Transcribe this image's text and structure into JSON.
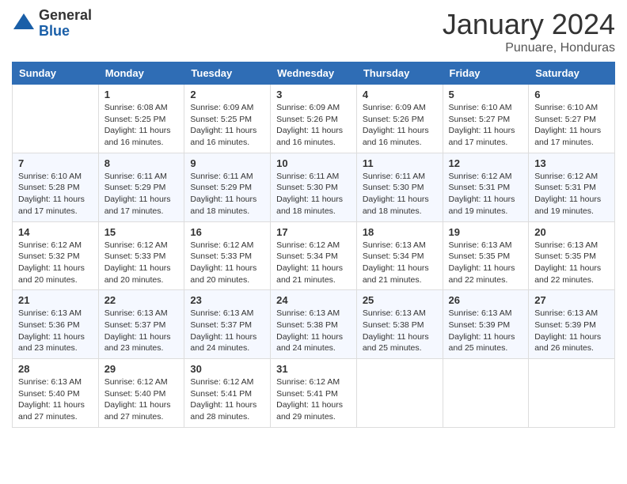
{
  "logo": {
    "general": "General",
    "blue": "Blue"
  },
  "title": "January 2024",
  "subtitle": "Punuare, Honduras",
  "days": [
    "Sunday",
    "Monday",
    "Tuesday",
    "Wednesday",
    "Thursday",
    "Friday",
    "Saturday"
  ],
  "weeks": [
    [
      {
        "day": "",
        "sunrise": "",
        "sunset": "",
        "daylight": ""
      },
      {
        "day": "1",
        "sunrise": "Sunrise: 6:08 AM",
        "sunset": "Sunset: 5:25 PM",
        "daylight": "Daylight: 11 hours and 16 minutes."
      },
      {
        "day": "2",
        "sunrise": "Sunrise: 6:09 AM",
        "sunset": "Sunset: 5:25 PM",
        "daylight": "Daylight: 11 hours and 16 minutes."
      },
      {
        "day": "3",
        "sunrise": "Sunrise: 6:09 AM",
        "sunset": "Sunset: 5:26 PM",
        "daylight": "Daylight: 11 hours and 16 minutes."
      },
      {
        "day": "4",
        "sunrise": "Sunrise: 6:09 AM",
        "sunset": "Sunset: 5:26 PM",
        "daylight": "Daylight: 11 hours and 16 minutes."
      },
      {
        "day": "5",
        "sunrise": "Sunrise: 6:10 AM",
        "sunset": "Sunset: 5:27 PM",
        "daylight": "Daylight: 11 hours and 17 minutes."
      },
      {
        "day": "6",
        "sunrise": "Sunrise: 6:10 AM",
        "sunset": "Sunset: 5:27 PM",
        "daylight": "Daylight: 11 hours and 17 minutes."
      }
    ],
    [
      {
        "day": "7",
        "sunrise": "Sunrise: 6:10 AM",
        "sunset": "Sunset: 5:28 PM",
        "daylight": "Daylight: 11 hours and 17 minutes."
      },
      {
        "day": "8",
        "sunrise": "Sunrise: 6:11 AM",
        "sunset": "Sunset: 5:29 PM",
        "daylight": "Daylight: 11 hours and 17 minutes."
      },
      {
        "day": "9",
        "sunrise": "Sunrise: 6:11 AM",
        "sunset": "Sunset: 5:29 PM",
        "daylight": "Daylight: 11 hours and 18 minutes."
      },
      {
        "day": "10",
        "sunrise": "Sunrise: 6:11 AM",
        "sunset": "Sunset: 5:30 PM",
        "daylight": "Daylight: 11 hours and 18 minutes."
      },
      {
        "day": "11",
        "sunrise": "Sunrise: 6:11 AM",
        "sunset": "Sunset: 5:30 PM",
        "daylight": "Daylight: 11 hours and 18 minutes."
      },
      {
        "day": "12",
        "sunrise": "Sunrise: 6:12 AM",
        "sunset": "Sunset: 5:31 PM",
        "daylight": "Daylight: 11 hours and 19 minutes."
      },
      {
        "day": "13",
        "sunrise": "Sunrise: 6:12 AM",
        "sunset": "Sunset: 5:31 PM",
        "daylight": "Daylight: 11 hours and 19 minutes."
      }
    ],
    [
      {
        "day": "14",
        "sunrise": "Sunrise: 6:12 AM",
        "sunset": "Sunset: 5:32 PM",
        "daylight": "Daylight: 11 hours and 20 minutes."
      },
      {
        "day": "15",
        "sunrise": "Sunrise: 6:12 AM",
        "sunset": "Sunset: 5:33 PM",
        "daylight": "Daylight: 11 hours and 20 minutes."
      },
      {
        "day": "16",
        "sunrise": "Sunrise: 6:12 AM",
        "sunset": "Sunset: 5:33 PM",
        "daylight": "Daylight: 11 hours and 20 minutes."
      },
      {
        "day": "17",
        "sunrise": "Sunrise: 6:12 AM",
        "sunset": "Sunset: 5:34 PM",
        "daylight": "Daylight: 11 hours and 21 minutes."
      },
      {
        "day": "18",
        "sunrise": "Sunrise: 6:13 AM",
        "sunset": "Sunset: 5:34 PM",
        "daylight": "Daylight: 11 hours and 21 minutes."
      },
      {
        "day": "19",
        "sunrise": "Sunrise: 6:13 AM",
        "sunset": "Sunset: 5:35 PM",
        "daylight": "Daylight: 11 hours and 22 minutes."
      },
      {
        "day": "20",
        "sunrise": "Sunrise: 6:13 AM",
        "sunset": "Sunset: 5:35 PM",
        "daylight": "Daylight: 11 hours and 22 minutes."
      }
    ],
    [
      {
        "day": "21",
        "sunrise": "Sunrise: 6:13 AM",
        "sunset": "Sunset: 5:36 PM",
        "daylight": "Daylight: 11 hours and 23 minutes."
      },
      {
        "day": "22",
        "sunrise": "Sunrise: 6:13 AM",
        "sunset": "Sunset: 5:37 PM",
        "daylight": "Daylight: 11 hours and 23 minutes."
      },
      {
        "day": "23",
        "sunrise": "Sunrise: 6:13 AM",
        "sunset": "Sunset: 5:37 PM",
        "daylight": "Daylight: 11 hours and 24 minutes."
      },
      {
        "day": "24",
        "sunrise": "Sunrise: 6:13 AM",
        "sunset": "Sunset: 5:38 PM",
        "daylight": "Daylight: 11 hours and 24 minutes."
      },
      {
        "day": "25",
        "sunrise": "Sunrise: 6:13 AM",
        "sunset": "Sunset: 5:38 PM",
        "daylight": "Daylight: 11 hours and 25 minutes."
      },
      {
        "day": "26",
        "sunrise": "Sunrise: 6:13 AM",
        "sunset": "Sunset: 5:39 PM",
        "daylight": "Daylight: 11 hours and 25 minutes."
      },
      {
        "day": "27",
        "sunrise": "Sunrise: 6:13 AM",
        "sunset": "Sunset: 5:39 PM",
        "daylight": "Daylight: 11 hours and 26 minutes."
      }
    ],
    [
      {
        "day": "28",
        "sunrise": "Sunrise: 6:13 AM",
        "sunset": "Sunset: 5:40 PM",
        "daylight": "Daylight: 11 hours and 27 minutes."
      },
      {
        "day": "29",
        "sunrise": "Sunrise: 6:12 AM",
        "sunset": "Sunset: 5:40 PM",
        "daylight": "Daylight: 11 hours and 27 minutes."
      },
      {
        "day": "30",
        "sunrise": "Sunrise: 6:12 AM",
        "sunset": "Sunset: 5:41 PM",
        "daylight": "Daylight: 11 hours and 28 minutes."
      },
      {
        "day": "31",
        "sunrise": "Sunrise: 6:12 AM",
        "sunset": "Sunset: 5:41 PM",
        "daylight": "Daylight: 11 hours and 29 minutes."
      },
      {
        "day": "",
        "sunrise": "",
        "sunset": "",
        "daylight": ""
      },
      {
        "day": "",
        "sunrise": "",
        "sunset": "",
        "daylight": ""
      },
      {
        "day": "",
        "sunrise": "",
        "sunset": "",
        "daylight": ""
      }
    ]
  ]
}
